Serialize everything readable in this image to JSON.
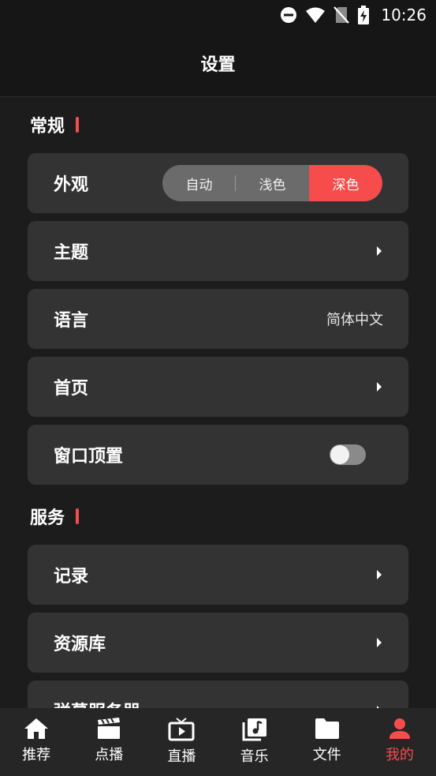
{
  "status_bar": {
    "time": "10:26"
  },
  "header": {
    "title": "设置"
  },
  "sections": {
    "general": {
      "title": "常规"
    },
    "service": {
      "title": "服务"
    }
  },
  "appearance": {
    "label": "外观",
    "options": [
      "自动",
      "浅色",
      "深色"
    ],
    "selected": "深色"
  },
  "theme": {
    "label": "主题"
  },
  "language": {
    "label": "语言",
    "value": "简体中文"
  },
  "homepage": {
    "label": "首页"
  },
  "window_on_top": {
    "label": "窗口顶置",
    "enabled": false
  },
  "records": {
    "label": "记录"
  },
  "library": {
    "label": "资源库"
  },
  "danmaku_server": {
    "label": "弹幕服务器"
  },
  "bottom_nav": {
    "items": [
      {
        "label": "推荐",
        "icon": "home-icon"
      },
      {
        "label": "点播",
        "icon": "clapperboard-icon"
      },
      {
        "label": "直播",
        "icon": "tv-icon"
      },
      {
        "label": "音乐",
        "icon": "music-icon"
      },
      {
        "label": "文件",
        "icon": "folder-icon"
      },
      {
        "label": "我的",
        "icon": "person-icon"
      }
    ],
    "active": "我的"
  },
  "colors": {
    "accent": "#f64c4c",
    "card": "#333333",
    "background": "#1c1c1c",
    "bar": "#161616"
  }
}
